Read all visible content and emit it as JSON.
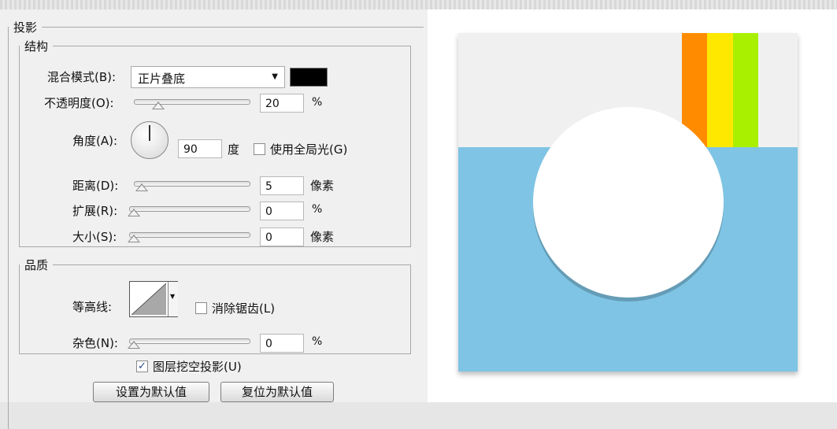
{
  "section": {
    "title": "投影"
  },
  "structure": {
    "title": "结构",
    "blend_mode": {
      "label": "混合模式(B):",
      "value": "正片叠底",
      "color": "#000000"
    },
    "opacity": {
      "label": "不透明度(O):",
      "value": "20",
      "unit": "%",
      "level": 0.2
    },
    "angle": {
      "label": "角度(A):",
      "value": "90",
      "unit": "度",
      "global_light_label": "使用全局光(G)",
      "global_light_checked": false
    },
    "distance": {
      "label": "距离(D):",
      "value": "5",
      "unit": "像素"
    },
    "spread": {
      "label": "扩展(R):",
      "value": "0",
      "unit": "%"
    },
    "size": {
      "label": "大小(S):",
      "value": "0",
      "unit": "像素"
    }
  },
  "quality": {
    "title": "品质",
    "contour": {
      "label": "等高线:",
      "anti_alias_label": "消除锯齿(L)",
      "anti_alias_checked": false
    },
    "noise": {
      "label": "杂色(N):",
      "value": "0",
      "unit": "%"
    }
  },
  "knockout": {
    "label": "图层挖空投影(U)",
    "checked": true
  },
  "buttons": {
    "set_default": "设置为默认值",
    "reset_default": "复位为默认值"
  },
  "colors": {
    "preview_blue": "#7fc4e4",
    "preview_gray": "#f0f0f0",
    "stripe_orange": "#ff8c00",
    "stripe_yellow": "#ffe800",
    "stripe_lime": "#a8f000",
    "circle": "#ffffff"
  }
}
